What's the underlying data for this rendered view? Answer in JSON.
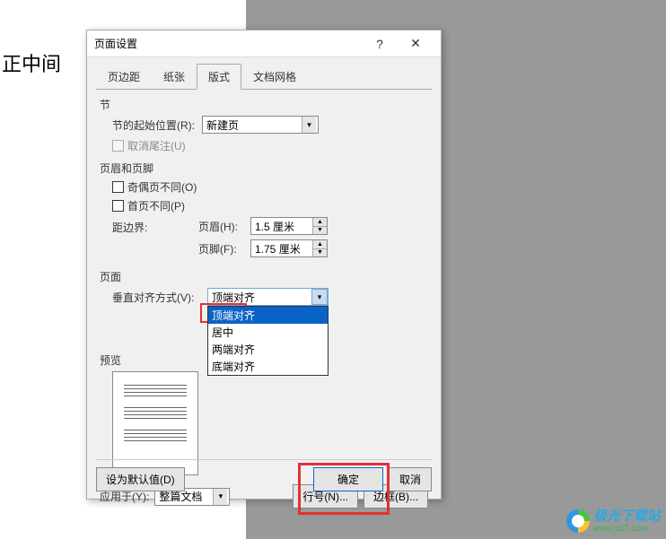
{
  "bg_text": "正中间",
  "dialog": {
    "title": "页面设置",
    "tabs": [
      "页边距",
      "纸张",
      "版式",
      "文档网格"
    ],
    "active_tab": "版式",
    "section": {
      "label": "节",
      "start_label": "节的起始位置(R):",
      "start_value": "新建页",
      "cancel_endnote": "取消尾注(U)"
    },
    "headerfooter": {
      "label": "页眉和页脚",
      "odd_even": "奇偶页不同(O)",
      "first_page": "首页不同(P)",
      "margin_label": "距边界:",
      "header_label": "页眉(H):",
      "header_value": "1.5 厘米",
      "footer_label": "页脚(F):",
      "footer_value": "1.75 厘米"
    },
    "page": {
      "label": "页面",
      "valign_label": "垂直对齐方式(V):",
      "valign_value": "顶端对齐",
      "options": [
        "顶端对齐",
        "居中",
        "两端对齐",
        "底端对齐"
      ]
    },
    "preview_label": "预览",
    "apply_label": "应用于(Y):",
    "apply_value": "整篇文档",
    "line_num_btn": "行号(N)...",
    "border_btn": "边框(B)...",
    "default_btn": "设为默认值(D)",
    "ok_btn": "确定",
    "cancel_btn": "取消"
  },
  "watermark": {
    "cn": "极光下载站",
    "en": "www.xz7.com"
  }
}
